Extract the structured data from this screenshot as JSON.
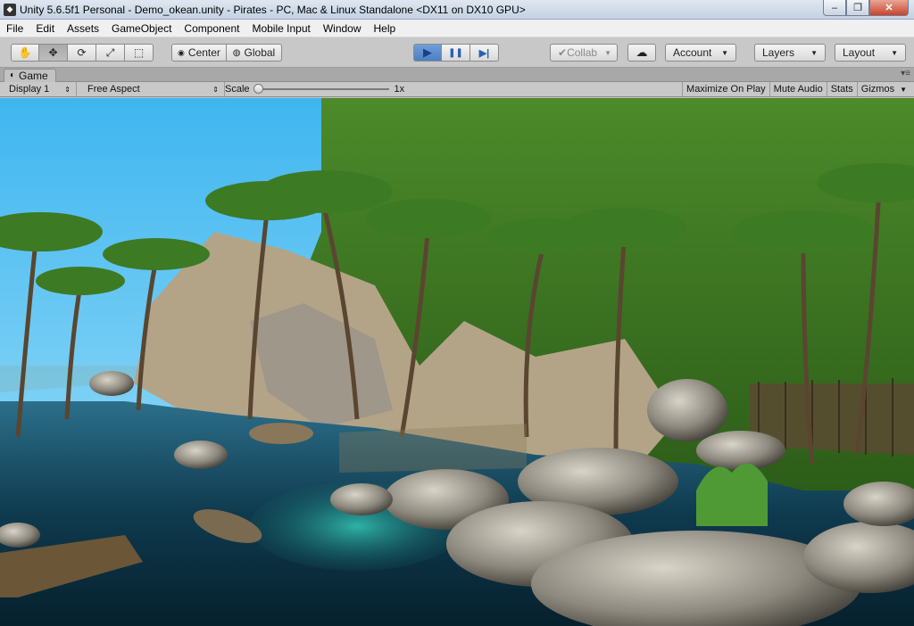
{
  "window": {
    "title": "Unity 5.6.5f1 Personal - Demo_okean.unity - Pirates - PC, Mac & Linux Standalone <DX11 on DX10 GPU>",
    "icon": "unity-icon",
    "minimize": "–",
    "maximize": "❐",
    "close": "✕"
  },
  "menu": [
    "File",
    "Edit",
    "Assets",
    "GameObject",
    "Component",
    "Mobile Input",
    "Window",
    "Help"
  ],
  "toolbar": {
    "tools": [
      {
        "name": "hand-tool-icon",
        "glyph": "✋"
      },
      {
        "name": "move-tool-icon",
        "glyph": "✥"
      },
      {
        "name": "rotate-tool-icon",
        "glyph": "⟳"
      },
      {
        "name": "scale-tool-icon",
        "glyph": "⤢"
      },
      {
        "name": "rect-tool-icon",
        "glyph": "⬚"
      }
    ],
    "pivot_label": "Center",
    "space_label": "Global",
    "play_icon": "▶",
    "pause_icon": "❚❚",
    "step_icon": "▶|",
    "collab_label": "Collab",
    "cloud_icon": "☁",
    "account_label": "Account",
    "layers_label": "Layers",
    "layout_label": "Layout",
    "accent": "#4b7fc3"
  },
  "game_panel": {
    "tab_label": "Game",
    "display_label": "Display 1",
    "aspect_label": "Free Aspect",
    "scale_label": "Scale",
    "scale_value": "1x",
    "maximize_label": "Maximize On Play",
    "mute_label": "Mute Audio",
    "stats_label": "Stats",
    "gizmos_label": "Gizmos"
  }
}
